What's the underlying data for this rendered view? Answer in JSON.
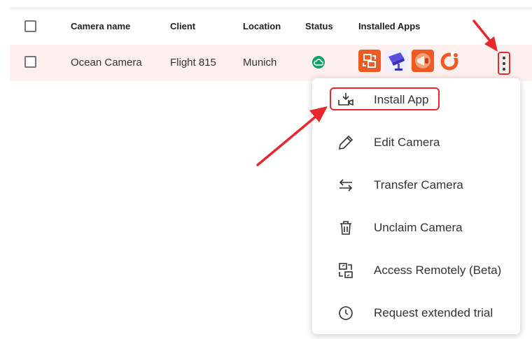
{
  "table": {
    "headers": {
      "camera_name": "Camera name",
      "client": "Client",
      "location": "Location",
      "status": "Status",
      "installed_apps": "Installed Apps"
    },
    "rows": [
      {
        "camera_name": "Ocean Camera",
        "client": "Flight 815",
        "location": "Munich",
        "status_icon": "cloud-online-icon",
        "apps": [
          "remote-access-app-icon",
          "camera-app-icon",
          "megaphone-app-icon",
          "orange-ring-app-icon"
        ]
      }
    ]
  },
  "menu": {
    "items": [
      {
        "label": "Install App",
        "icon": "install-app-icon"
      },
      {
        "label": "Edit Camera",
        "icon": "pencil-icon"
      },
      {
        "label": "Transfer Camera",
        "icon": "transfer-arrows-icon"
      },
      {
        "label": "Unclaim Camera",
        "icon": "trash-icon"
      },
      {
        "label": "Access Remotely (Beta)",
        "icon": "remote-access-icon"
      },
      {
        "label": "Request extended trial",
        "icon": "clock-icon"
      }
    ]
  },
  "colors": {
    "annotation_red": "#e8282c",
    "status_green": "#14a06a",
    "row_highlight": "#fdf0ee",
    "app_orange": "#ee5a24"
  }
}
